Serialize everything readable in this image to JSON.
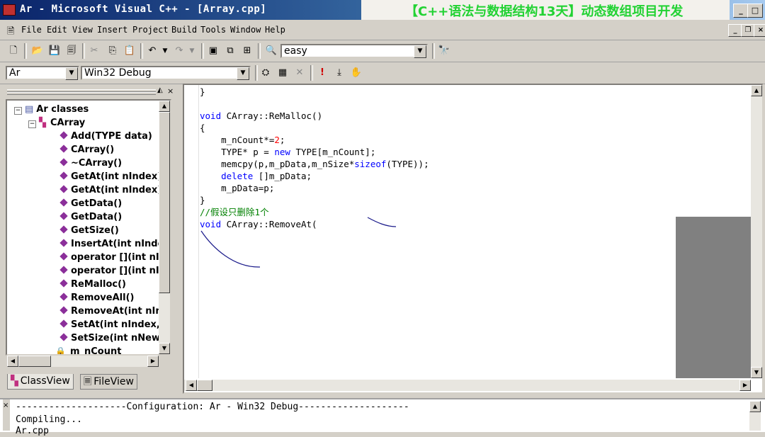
{
  "window": {
    "title": "Ar - Microsoft Visual C++ - [Array.cpp]",
    "banner": "【C++语法与数据结构13天】动态数组项目开发",
    "controls": {
      "minimize": "_",
      "maximize": "□",
      "close": "×"
    }
  },
  "menubar": {
    "items": [
      "File",
      "Edit",
      "View",
      "Insert",
      "Project",
      "Build",
      "Tools",
      "Window",
      "Help"
    ]
  },
  "toolbar1": {
    "find_combo_value": "easy"
  },
  "toolbar2": {
    "project_combo_value": "Ar",
    "config_combo_value": "Win32 Debug"
  },
  "classview": {
    "root": "Ar classes",
    "class": "CArray",
    "members": [
      "Add(TYPE data)",
      "CArray()",
      "~CArray()",
      "GetAt(int nIndex)",
      "GetAt(int nIndex)",
      "GetData()",
      "GetData()",
      "GetSize()",
      "InsertAt(int nIndex,",
      "operator [](int nInd",
      "operator [](int nInd",
      "ReMalloc()",
      "RemoveAll()",
      "RemoveAt(int nInd",
      "SetAt(int nIndex, T",
      "SetSize(int nNewS",
      "m_nCount"
    ],
    "tabs": [
      "ClassView",
      "FileView"
    ]
  },
  "editor": {
    "file": "Array.cpp"
  },
  "output": {
    "lines": [
      "--------------------Configuration: Ar - Win32 Debug--------------------",
      "Compiling...",
      "Ar.cpp"
    ]
  }
}
